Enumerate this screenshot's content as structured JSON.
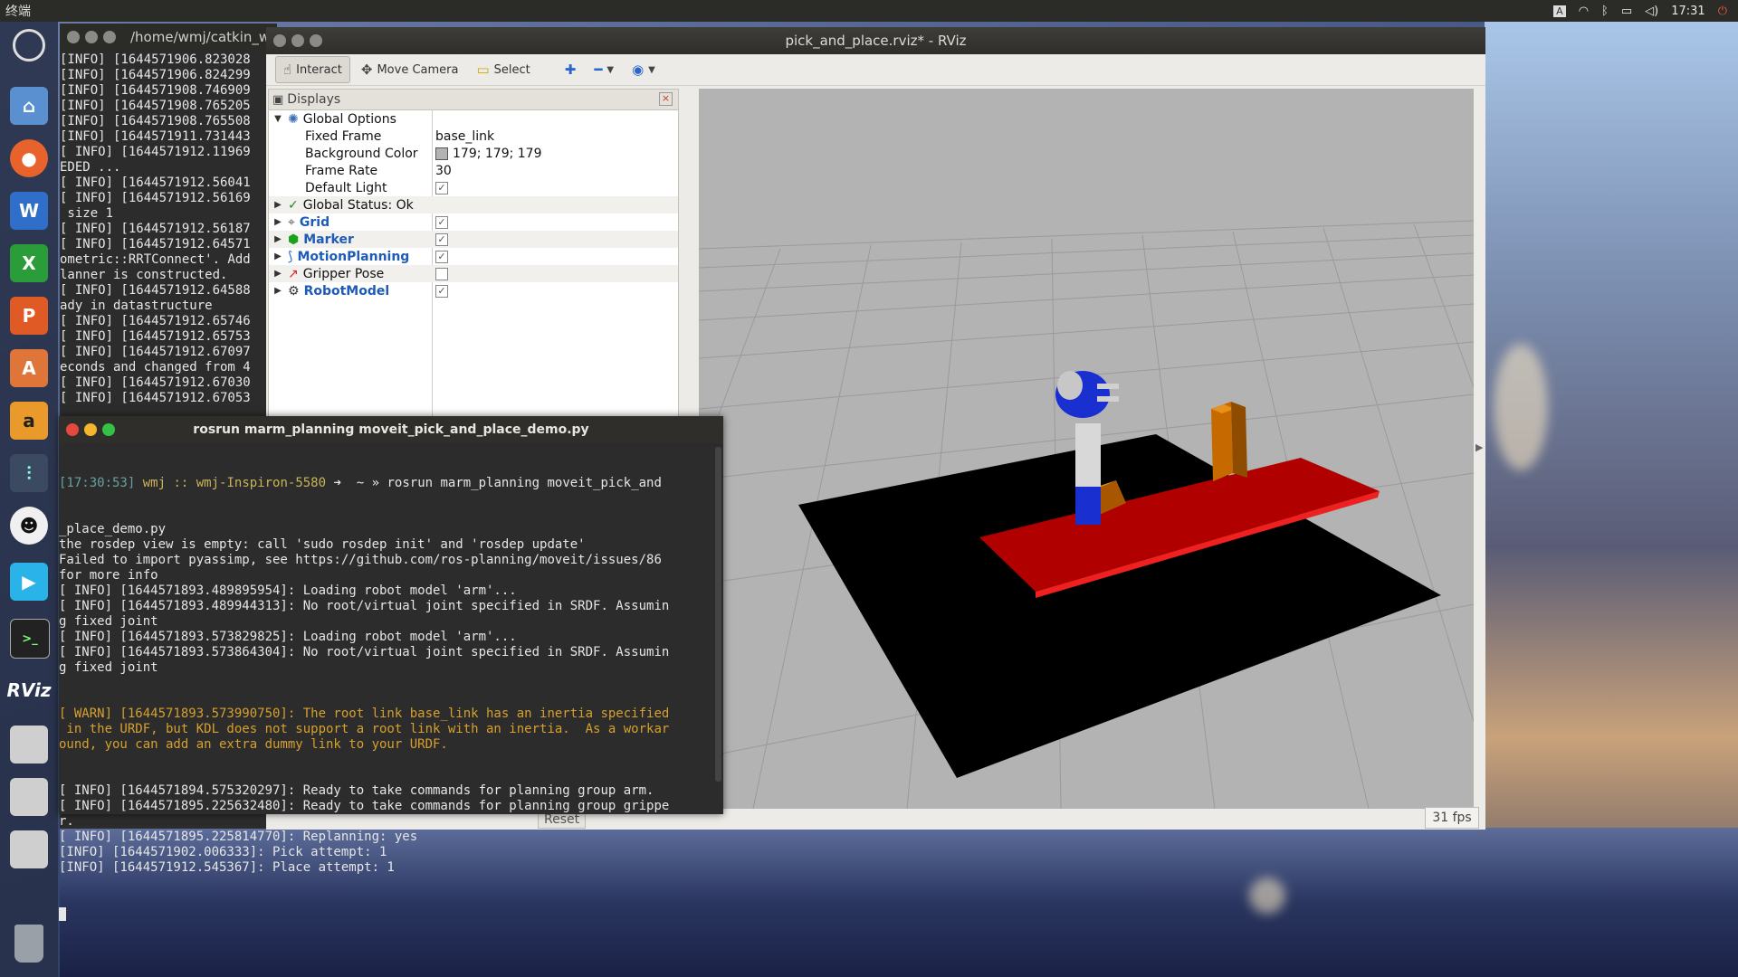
{
  "top_panel": {
    "app_name": "终端",
    "indicators": [
      "A",
      "wifi-icon",
      "bluetooth-icon",
      "battery-icon",
      "volume-icon"
    ],
    "clock": "17:31"
  },
  "launcher": {
    "items": [
      "ubuntu-dash-icon",
      "home-folder-icon",
      "firefox-icon",
      "writer-icon",
      "calc-icon",
      "impress-icon",
      "software-center-icon",
      "amazon-icon",
      "settings-icon",
      "qq-icon",
      "video-player-icon",
      "terminal-icon",
      "rviz-icon",
      "drive-icon",
      "drive-icon",
      "drive-icon",
      "trash-icon"
    ],
    "rviz_label": "RViz"
  },
  "bg_terminal": {
    "title": "/home/wmj/catkin_w",
    "lines": [
      "[INFO] [1644571906.823028",
      "[INFO] [1644571906.824299",
      "[INFO] [1644571908.746909",
      "[INFO] [1644571908.765205",
      "[INFO] [1644571908.765508",
      "[INFO] [1644571911.731443",
      "[ INFO] [1644571912.11969",
      "EDED ...",
      "[ INFO] [1644571912.56041",
      "[ INFO] [1644571912.56169",
      " size 1",
      "[ INFO] [1644571912.56187",
      "[ INFO] [1644571912.64571",
      "ometric::RRTConnect'. Add",
      "lanner is constructed.",
      "[ INFO] [1644571912.64588",
      "ady in datastructure",
      "[ INFO] [1644571912.65746",
      "[ INFO] [1644571912.65753",
      "[ INFO] [1644571912.67097",
      "econds and changed from 4",
      "[ INFO] [1644571912.67030",
      "[ INFO] [1644571912.67053"
    ]
  },
  "rviz": {
    "title": "pick_and_place.rviz* - RViz",
    "toolbar": {
      "interact": "Interact",
      "move_camera": "Move Camera",
      "select": "Select"
    },
    "displays": {
      "header": "Displays",
      "rows": [
        {
          "label": "Global Options",
          "value": ""
        },
        {
          "label": "Fixed Frame",
          "value": "base_link"
        },
        {
          "label": "Background Color",
          "value": "179; 179; 179"
        },
        {
          "label": "Frame Rate",
          "value": "30"
        },
        {
          "label": "Default Light",
          "value": ""
        },
        {
          "label": "Global Status: Ok",
          "value": ""
        },
        {
          "label": "Grid",
          "value": ""
        },
        {
          "label": "Marker",
          "value": ""
        },
        {
          "label": "MotionPlanning",
          "value": ""
        },
        {
          "label": "Gripper Pose",
          "value": ""
        },
        {
          "label": "RobotModel",
          "value": ""
        }
      ],
      "checked": [
        true,
        true,
        true,
        true,
        false,
        true
      ]
    },
    "reset_label": "Reset",
    "fps": "31 fps",
    "colors": {
      "background": "#b3b3b3",
      "table": "#000000",
      "board": "#b00000",
      "block": "#c86a00",
      "arm_blue": "#1a2fd0"
    }
  },
  "fg_terminal": {
    "title": "rosrun marm_planning moveit_pick_and_place_demo.py",
    "prompt_time": "[17:30:53]",
    "prompt_user": "wmj",
    "prompt_host": ":: wmj-Inspiron-5580",
    "prompt_cmd": " ➜  ~ » rosrun marm_planning moveit_pick_and",
    "lines": [
      "_place_demo.py",
      "the rosdep view is empty: call 'sudo rosdep init' and 'rosdep update'",
      "Failed to import pyassimp, see https://github.com/ros-planning/moveit/issues/86",
      "for more info",
      "[ INFO] [1644571893.489895954]: Loading robot model 'arm'...",
      "[ INFO] [1644571893.489944313]: No root/virtual joint specified in SRDF. Assumin",
      "g fixed joint",
      "[ INFO] [1644571893.573829825]: Loading robot model 'arm'...",
      "[ INFO] [1644571893.573864304]: No root/virtual joint specified in SRDF. Assumin",
      "g fixed joint"
    ],
    "warn_lines": [
      "[ WARN] [1644571893.573990750]: The root link base_link has an inertia specified",
      " in the URDF, but KDL does not support a root link with an inertia.  As a workar",
      "ound, you can add an extra dummy link to your URDF."
    ],
    "tail_lines": [
      "[ INFO] [1644571894.575320297]: Ready to take commands for planning group arm.",
      "[ INFO] [1644571895.225632480]: Ready to take commands for planning group grippe",
      "r.",
      "[ INFO] [1644571895.225814770]: Replanning: yes",
      "[INFO] [1644571902.006333]: Pick attempt: 1",
      "[INFO] [1644571912.545367]: Place attempt: 1"
    ]
  }
}
